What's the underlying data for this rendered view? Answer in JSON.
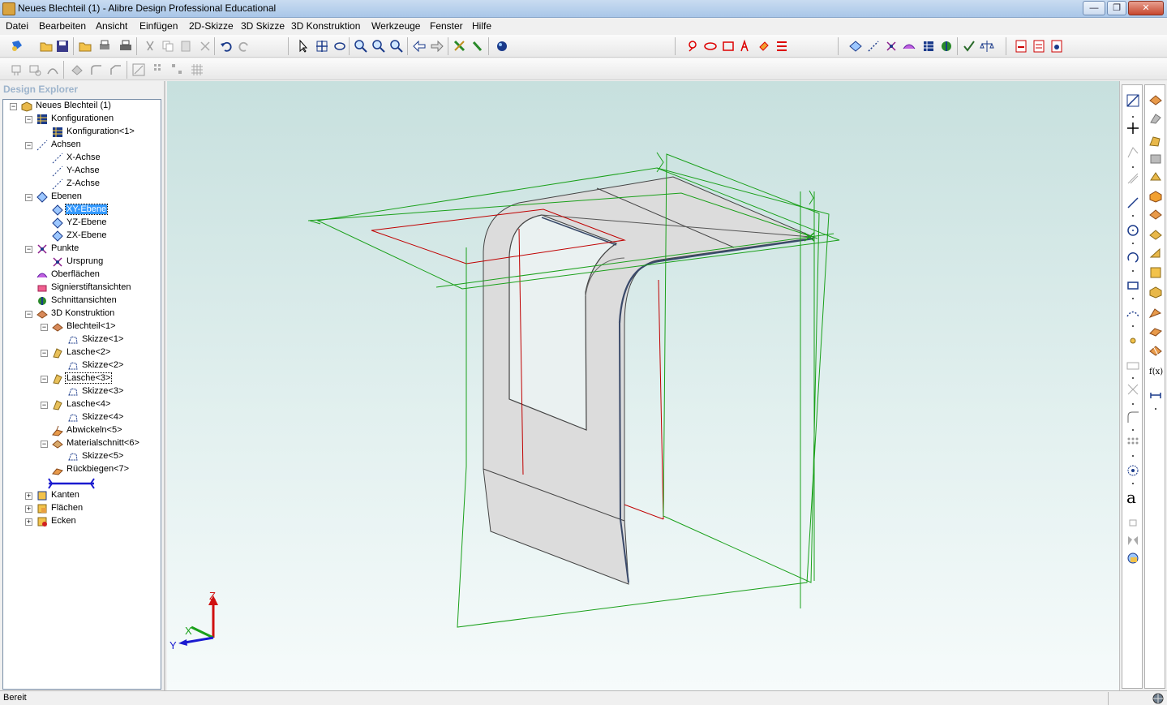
{
  "window": {
    "title": "Neues Blechteil (1) - Alibre Design Professional Educational",
    "min": "—",
    "max": "❐",
    "close": "✕"
  },
  "menu": [
    "Datei",
    "Bearbeiten",
    "Ansicht",
    "Einfügen",
    "2D-Skizze",
    "3D Skizze",
    "3D Konstruktion",
    "Werkzeuge",
    "Fenster",
    "Hilfe"
  ],
  "explorer": {
    "title": "Design Explorer",
    "tree": [
      {
        "label": "Neues Blechteil (1)",
        "icon": "part-icon"
      },
      {
        "label": "Konfigurationen",
        "icon": "table-icon"
      },
      {
        "label": "Konfiguration<1>",
        "icon": "table-icon"
      },
      {
        "label": "Achsen",
        "icon": "axis-icon"
      },
      {
        "label": "X-Achse",
        "icon": "axis-icon"
      },
      {
        "label": "Y-Achse",
        "icon": "axis-icon"
      },
      {
        "label": "Z-Achse",
        "icon": "axis-icon"
      },
      {
        "label": "Ebenen",
        "icon": "plane-icon"
      },
      {
        "label": "XY-Ebene",
        "icon": "plane-icon",
        "selected": true
      },
      {
        "label": "YZ-Ebene",
        "icon": "plane-icon"
      },
      {
        "label": "ZX-Ebene",
        "icon": "plane-icon"
      },
      {
        "label": "Punkte",
        "icon": "point-icon"
      },
      {
        "label": "Ursprung",
        "icon": "point-icon"
      },
      {
        "label": "Oberflächen",
        "icon": "surface-icon"
      },
      {
        "label": "Signierstiftansichten",
        "icon": "marker-icon"
      },
      {
        "label": "Schnittansichten",
        "icon": "section-icon"
      },
      {
        "label": "3D Konstruktion",
        "icon": "feature-icon"
      },
      {
        "label": "Blechteil<1>",
        "icon": "sheet-icon"
      },
      {
        "label": "Skizze<1>",
        "icon": "sketch-icon"
      },
      {
        "label": "Lasche<2>",
        "icon": "flange-icon"
      },
      {
        "label": "Skizze<2>",
        "icon": "sketch-icon"
      },
      {
        "label": "Lasche<3>",
        "icon": "flange-icon",
        "focus": true
      },
      {
        "label": "Skizze<3>",
        "icon": "sketch-icon"
      },
      {
        "label": "Lasche<4>",
        "icon": "flange-icon"
      },
      {
        "label": "Skizze<4>",
        "icon": "sketch-icon"
      },
      {
        "label": "Abwickeln<5>",
        "icon": "unfold-icon"
      },
      {
        "label": "Materialschnitt<6>",
        "icon": "cut-icon"
      },
      {
        "label": "Skizze<5>",
        "icon": "sketch-icon"
      },
      {
        "label": "Rückbiegen<7>",
        "icon": "refold-icon"
      },
      {
        "label": "",
        "icon": "rollback-bar"
      },
      {
        "label": "Kanten",
        "icon": "edges-icon"
      },
      {
        "label": "Flächen",
        "icon": "faces-icon"
      },
      {
        "label": "Ecken",
        "icon": "vertices-icon"
      }
    ]
  },
  "axes_triad": {
    "x": "X",
    "y": "Y",
    "z": "Z"
  },
  "status": {
    "text": "Bereit"
  },
  "colors": {
    "accent": "#3399ff",
    "sketch_red": "#c00000",
    "plane_green": "#1aa01a",
    "part_gray": "#dcdcdc"
  }
}
